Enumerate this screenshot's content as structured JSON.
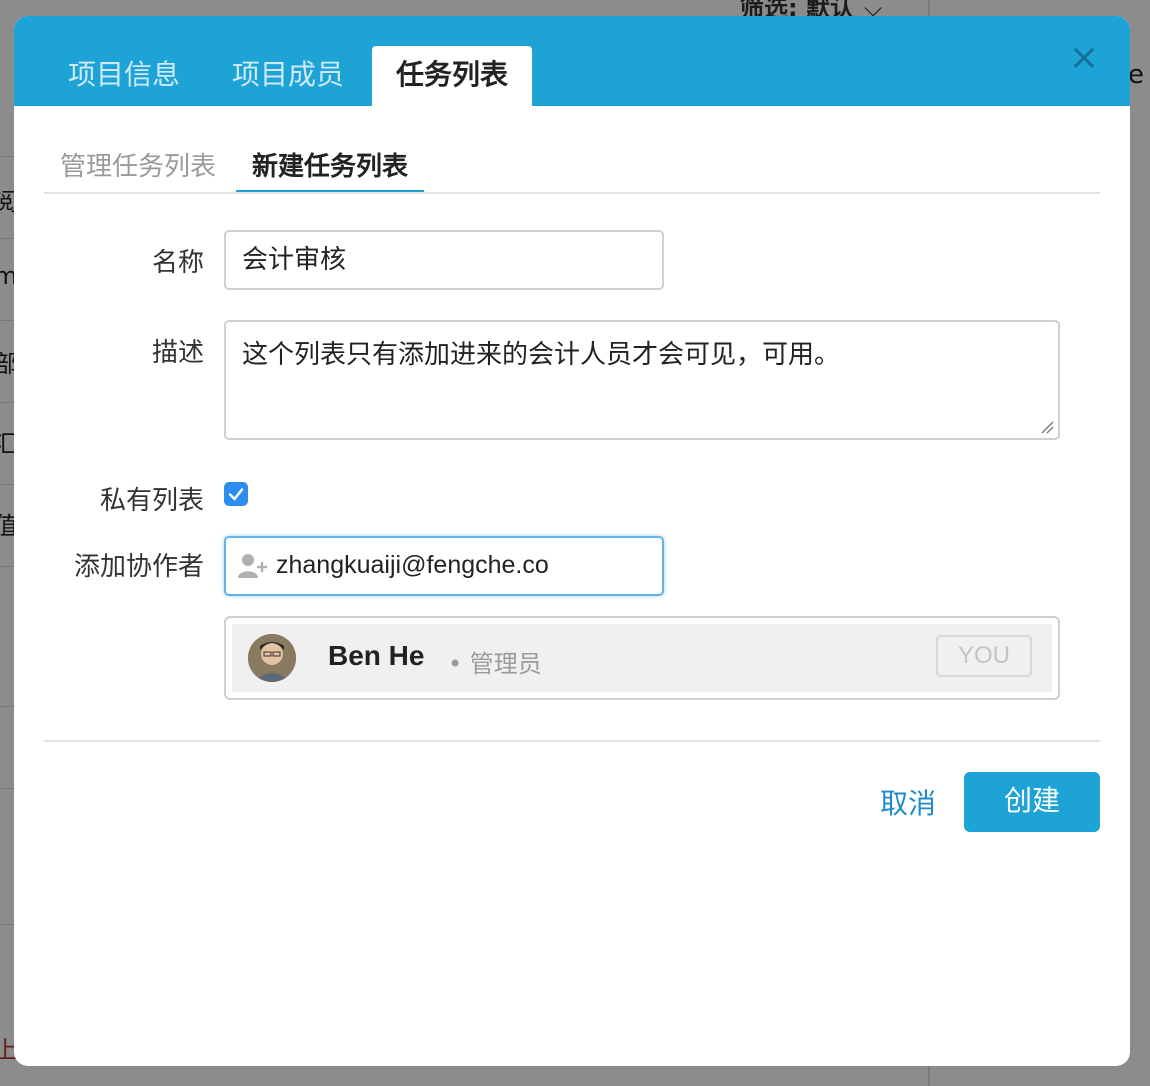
{
  "background": {
    "filter_label": "筛选: 默认",
    "right_glyph": "e",
    "left_glyphs": [
      "阅",
      "m",
      "部",
      "汇",
      "值",
      "上"
    ]
  },
  "tabs": {
    "info": "项目信息",
    "members": "项目成员",
    "tasklists": "任务列表"
  },
  "close_icon": "×",
  "subtabs": {
    "manage": "管理任务列表",
    "new": "新建任务列表"
  },
  "form": {
    "name_label": "名称",
    "name_value": "会计审核",
    "desc_label": "描述",
    "desc_value": "这个列表只有添加进来的会计人员才会可见，可用。",
    "private_label": "私有列表",
    "private_checked": true,
    "collab_label": "添加协作者",
    "collab_value": "zhangkuaiji@fengche.co"
  },
  "member": {
    "name": "Ben He",
    "role": "• 管理员",
    "badge": "YOU"
  },
  "actions": {
    "cancel": "取消",
    "create": "创建"
  },
  "colors": {
    "header": "#1ea3d6",
    "accent": "#1e8cc9",
    "checkbox": "#2d8ef0"
  }
}
